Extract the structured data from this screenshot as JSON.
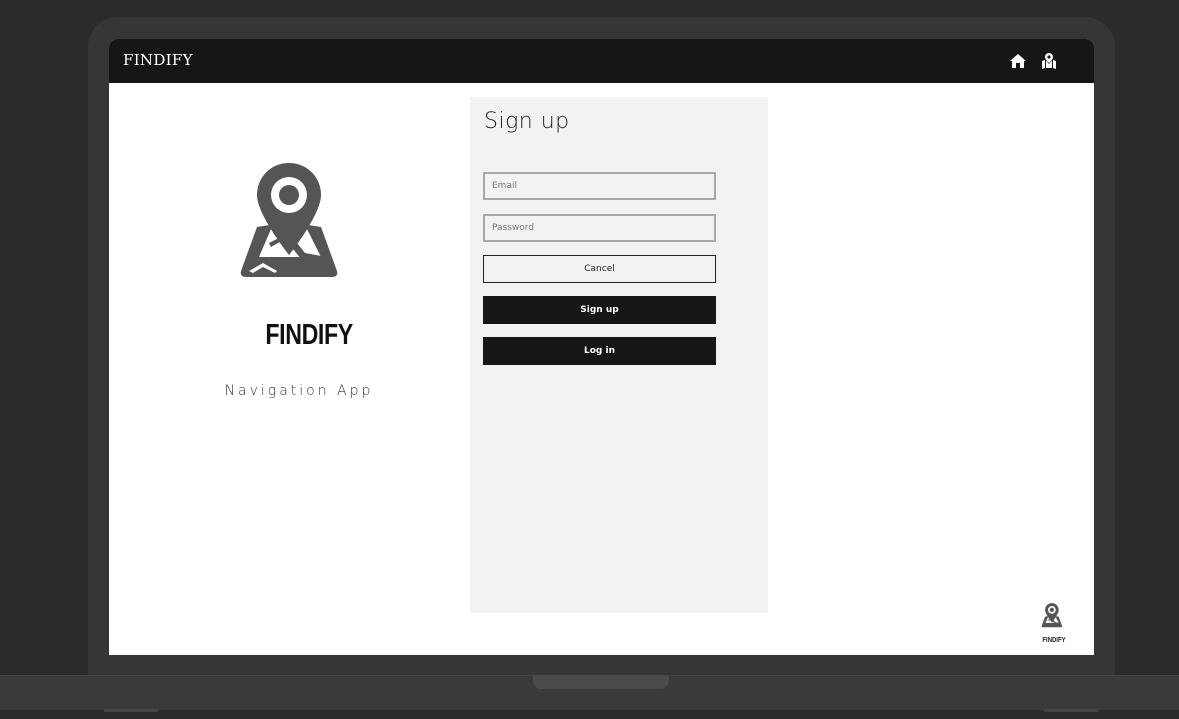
{
  "navbar": {
    "brand": "FINDIFY",
    "icons": [
      "home-icon",
      "map-marker-icon"
    ]
  },
  "hero": {
    "logo_text": "FINDIFY",
    "tagline": "Navigation App"
  },
  "signup_form": {
    "title": "Sign up",
    "email_placeholder": "Email",
    "password_placeholder": "Password",
    "cancel_label": "Cancel",
    "signup_label": "Sign up",
    "login_label": "Log in"
  },
  "footer": {
    "mini_logo_text": "FINDIFY"
  },
  "colors": {
    "navbar_bg": "#161616",
    "panel_bg": "#f2f2f2",
    "button_dark": "#161616",
    "logo_gray": "#555555"
  }
}
